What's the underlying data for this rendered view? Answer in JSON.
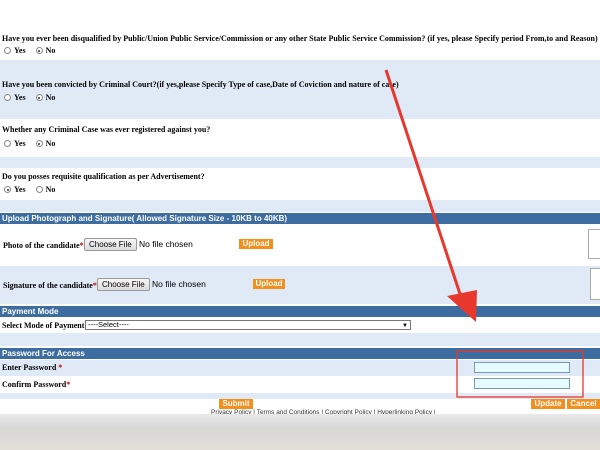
{
  "questions": [
    {
      "text": "Have you ever been disqualified by Public/Union Public Service/Commission or any other State Public Service Commission? (if yes, please Specify period From,to and Reason)",
      "yes": "Yes",
      "no": "No",
      "selected": "No"
    },
    {
      "text": "Have you been convicted by Criminal Court?(if yes,please Specify Type of case,Date of Coviction and nature of case)",
      "yes": "Yes",
      "no": "No",
      "selected": "No"
    },
    {
      "text": "Whether any Criminal Case was ever registered against you?",
      "yes": "Yes",
      "no": "No",
      "selected": "No"
    },
    {
      "text": "Do you posses requisite qualification as per Advertisement?",
      "yes": "Yes",
      "no": "No",
      "selected": "Yes"
    }
  ],
  "upload": {
    "header": "Upload Photograph and Signature( Allowed Signature Size - 10KB to 40KB)",
    "photo_label": "Photo of the candidate",
    "signature_label": "Signature of the candidate",
    "required_mark": "*",
    "choose_file": "Choose File",
    "no_file": "No file chosen",
    "upload_button": "Upload"
  },
  "payment": {
    "header": "Payment Mode",
    "label": "Select Mode of Payment",
    "selected": "----Select----"
  },
  "password": {
    "header": "Password For Access",
    "enter_label": "Enter Password",
    "confirm_label": "Confirm Password",
    "required_mark": "*"
  },
  "actions": {
    "submit": "Submit",
    "update": "Update",
    "cancel": "Cancel"
  },
  "footer": {
    "links": [
      "Privacy Policy",
      "Terms and Conditions",
      "Copyright Policy",
      "Hyperlinking Policy"
    ],
    "separator": "|"
  },
  "colors": {
    "header_bar": "#3d6da0",
    "light_band": "#dfeaf6",
    "orange_button": "#f28f1d",
    "annotation_red": "#e8372c",
    "input_fill": "#e6fbff"
  }
}
